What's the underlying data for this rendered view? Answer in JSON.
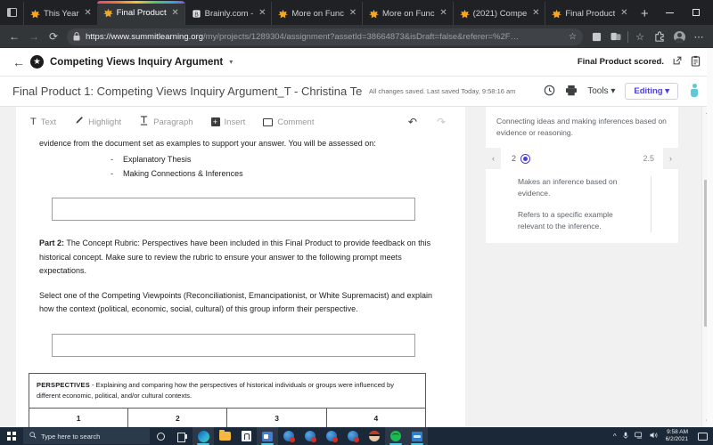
{
  "browser": {
    "tabs": [
      {
        "title": "This Year",
        "icon": "summit-star-favicon",
        "active": false
      },
      {
        "title": "Final Product",
        "icon": "summit-star-favicon",
        "active": true
      },
      {
        "title": "Brainly.com -",
        "icon": "brainly-favicon",
        "active": false
      },
      {
        "title": "More on Func",
        "icon": "summit-star-favicon",
        "active": false
      },
      {
        "title": "More on Func",
        "icon": "summit-star-favicon",
        "active": false
      },
      {
        "title": "(2021) Compe",
        "icon": "summit-star-favicon",
        "active": false
      },
      {
        "title": "Final Product",
        "icon": "summit-star-favicon",
        "active": false
      }
    ],
    "new_tab_label": "+",
    "close_label": "✕",
    "window_controls": {
      "minimize": "minimize-button",
      "maximize": "maximize-button",
      "close": "✕"
    },
    "nav": {
      "back": "←",
      "forward": "→",
      "reload": "⟳"
    },
    "url_domain": "https://www.summitlearning.org",
    "url_path": "/my/projects/1289304/assignment?assetId=38664873&isDraft=false&referer=%2F…",
    "lock_icon": "🔒",
    "favorite_icon": "☆",
    "toolbar_icons": [
      "collections-icon",
      "split-screen-icon",
      "favorites-icon",
      "extensions-icon",
      "profile-icon",
      "settings-more-icon"
    ],
    "more_label": "⋯"
  },
  "app_header": {
    "back_label": "←",
    "star_glyph": "★",
    "project_title": "Competing Views Inquiry Argument",
    "caret": "▾",
    "status_text": "Final Product scored.",
    "open_external_icon": "open-in-new-icon",
    "clipboard_icon": "clipboard-icon"
  },
  "doc_bar": {
    "document_title": "Final Product 1: Competing Views Inquiry Argument_T - Christina Te",
    "save_status": "All changes saved. Last saved Today, 9:58:16 am",
    "history_icon": "version-history-icon",
    "print_icon": "print-icon",
    "tools_label": "Tools",
    "tools_caret": "▾",
    "editing_label": "Editing",
    "editing_caret": "▾",
    "avatar": "user-avatar"
  },
  "format_toolbar": {
    "items": [
      {
        "label": "Text",
        "icon": "text-icon",
        "glyph": "T"
      },
      {
        "label": "Highlight",
        "icon": "highlight-pen-icon",
        "glyph": "✎"
      },
      {
        "label": "Paragraph",
        "icon": "paragraph-icon",
        "glyph": "⌶"
      },
      {
        "label": "Insert",
        "icon": "insert-plus-icon",
        "glyph": "+"
      },
      {
        "label": "Comment",
        "icon": "comment-icon",
        "glyph": ""
      }
    ],
    "undo_icon": "undo-icon",
    "undo_glyph": "↶",
    "redo_icon": "redo-icon",
    "redo_glyph": "↷"
  },
  "document": {
    "intro_paragraph": "evidence from the document set as examples to support your answer. You will be assessed on:",
    "bullets": [
      "Explanatory Thesis",
      "Making Connections & Inferences"
    ],
    "answer_box_1_value": "",
    "part2_label": "Part 2:",
    "part2_text": " The Concept Rubric: Perspectives have been included in this Final Product to provide feedback on this historical concept. Make sure to review the rubric to ensure your answer to the following prompt meets expectations.",
    "prompt_text": "Select one of the Competing Viewpoints (Reconciliationist, Emancipationist, or White Supremacist) and explain how the context (political, economic, social, cultural) of this group inform their perspective.",
    "answer_box_2_value": "",
    "rubric_table": {
      "header_label": "PERSPECTIVES",
      "header_text": " - Explaining and comparing how the perspectives of historical individuals or groups were influenced by different economic, political, and/or cultural contexts.",
      "columns": [
        "1",
        "2",
        "3",
        "4"
      ]
    }
  },
  "rubric_panel": {
    "description": "Connecting ideas and making inferences based on evidence or reasoning.",
    "prev_label": "‹",
    "next_label": "›",
    "score_current": "2",
    "score_next": "2.5",
    "criteria": [
      "Makes an inference based on evidence.",
      "Refers to a specific example relevant to the inference."
    ],
    "scroll_up": "▲",
    "scroll_down": "▼"
  },
  "taskbar": {
    "start_label": "windows-start",
    "search_placeholder": "Type here to search",
    "search_icon": "search-icon",
    "buttons": [
      {
        "name": "cortana-icon"
      },
      {
        "name": "task-view-icon"
      },
      {
        "name": "microsoft-edge-icon"
      },
      {
        "name": "file-explorer-icon"
      },
      {
        "name": "microsoft-store-icon"
      },
      {
        "name": "teams-icon"
      },
      {
        "name": "chrome-window-icon"
      },
      {
        "name": "chrome-window-icon"
      },
      {
        "name": "chrome-window-icon"
      },
      {
        "name": "chrome-window-icon"
      },
      {
        "name": "game-avatar-icon"
      },
      {
        "name": "spotify-icon"
      },
      {
        "name": "app-window-icon"
      }
    ],
    "tray": {
      "chevron": "^",
      "mic_icon": "microphone-icon",
      "network_icon": "network-icon",
      "volume_icon": "volume-icon",
      "time": "9:58 AM",
      "date": "6/2/2021",
      "notifications_icon": "notifications-icon"
    }
  },
  "colors": {
    "accent_purple": "#4b3fd0",
    "chrome_dark": "#202124",
    "taskbar": "#1b2838"
  }
}
